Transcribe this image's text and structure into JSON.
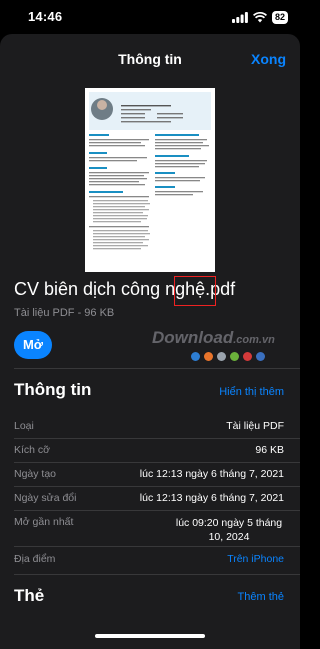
{
  "status_bar": {
    "time": "14:46",
    "battery": "82"
  },
  "header": {
    "title": "Thông tin",
    "done_label": "Xong"
  },
  "preview": {
    "person_name": "Vũ Thị Hương Giang",
    "person_role": "Biên dịch viên tiếng Anh"
  },
  "document": {
    "name": "CV biên dịch công nghệ.pdf",
    "meta": "Tài liệu PDF - 96 KB"
  },
  "open_label": "Mở",
  "watermark": {
    "main": "Download",
    "suffix": ".com.vn"
  },
  "info": {
    "title": "Thông tin",
    "show_more": "Hiển thị thêm",
    "rows": [
      {
        "label": "Loại",
        "value": "Tài liệu PDF"
      },
      {
        "label": "Kích cỡ",
        "value": "96 KB"
      },
      {
        "label": "Ngày tạo",
        "value": "lúc 12:13 ngày 6 tháng 7, 2021"
      },
      {
        "label": "Ngày sửa đổi",
        "value": "lúc 12:13 ngày 6 tháng 7, 2021"
      },
      {
        "label": "Mở gần nhất",
        "value": "lúc 09:20 ngày 5 tháng 10, 2024"
      },
      {
        "label": "Địa điểm",
        "value": "Trên iPhone"
      }
    ]
  },
  "tags": {
    "title": "Thẻ",
    "add_label": "Thêm thẻ"
  },
  "colors": {
    "accent": "#0a84ff",
    "sheet": "#1c1c1e",
    "highlight": "#ee2222"
  }
}
